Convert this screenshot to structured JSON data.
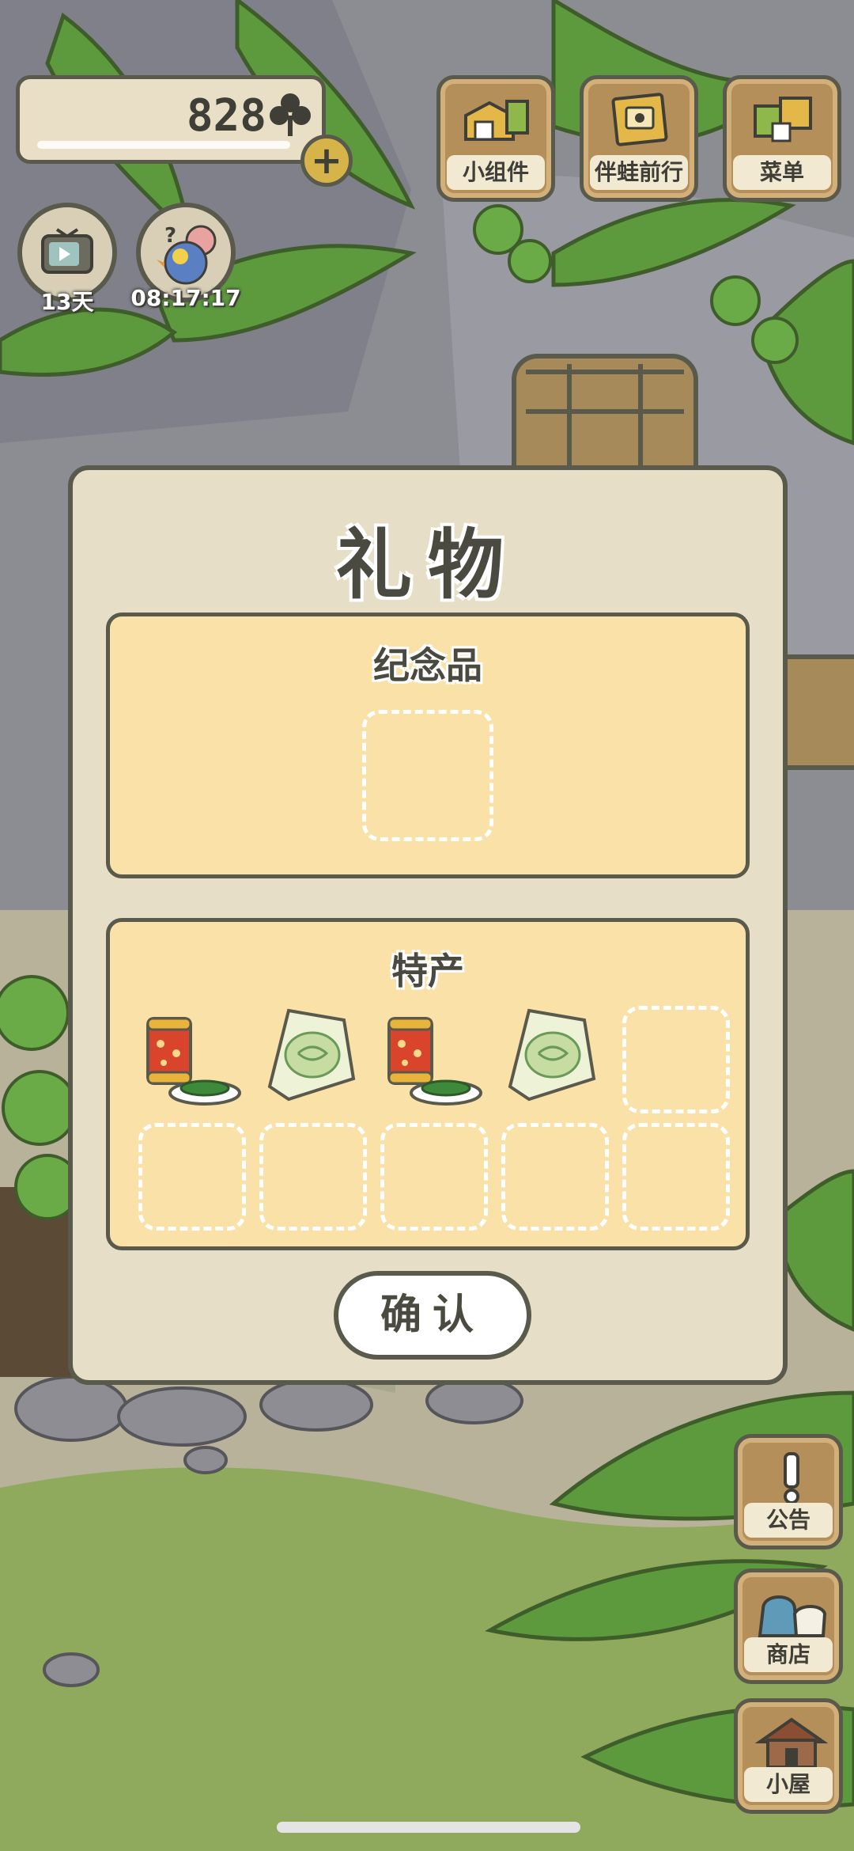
{
  "hud": {
    "clover_count": "828",
    "plus_label": "+",
    "tv_label": "13天",
    "timer_label": "08:17:17"
  },
  "top_menu": [
    {
      "label": "小组件",
      "icon": "widget-icon"
    },
    {
      "label": "伴蛙前行",
      "icon": "frog-companion-icon"
    },
    {
      "label": "菜单",
      "icon": "menu-icon"
    }
  ],
  "side_menu": [
    {
      "label": "公告",
      "icon": "notice-icon"
    },
    {
      "label": "商店",
      "icon": "shop-icon"
    },
    {
      "label": "小屋",
      "icon": "house-icon"
    }
  ],
  "modal": {
    "title": "礼物",
    "souvenir_section": {
      "title": "纪念品"
    },
    "specialty_section": {
      "title": "特产",
      "items": [
        "tea-can-with-edamame",
        "rice-cracker-bag",
        "tea-can-with-edamame",
        "rice-cracker-bag"
      ]
    },
    "confirm_label": "确认"
  }
}
